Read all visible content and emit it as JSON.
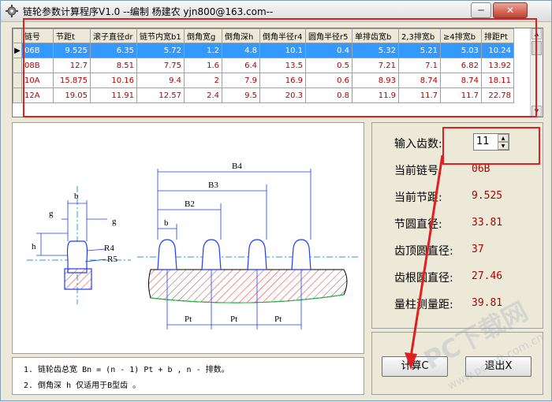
{
  "window": {
    "title": "链轮参数计算程序V1.0  --编制 杨建农 yjn800@163.com--",
    "minimize_glyph": "─",
    "close_glyph": "✕"
  },
  "grid": {
    "columns": [
      "链号",
      "节距t",
      "滚子直径dr",
      "链节内宽b1",
      "倒角宽g",
      "倒角深h",
      "倒角半径r4",
      "圆角半径r5",
      "单排齿宽b",
      "2,3排宽b",
      "≥4排宽b",
      "排距Pt"
    ],
    "rows": [
      {
        "selected": true,
        "cells": [
          "06B",
          "9.525",
          "6.35",
          "5.72",
          "1.2",
          "4.8",
          "10.1",
          "0.4",
          "5.32",
          "5.21",
          "5.03",
          "10.24"
        ]
      },
      {
        "selected": false,
        "cells": [
          "08B",
          "12.7",
          "8.51",
          "7.75",
          "1.6",
          "6.4",
          "13.5",
          "0.5",
          "7.21",
          "7.1",
          "6.82",
          "13.92"
        ]
      },
      {
        "selected": false,
        "cells": [
          "10A",
          "15.875",
          "10.16",
          "9.4",
          "2",
          "7.9",
          "16.9",
          "0.6",
          "8.93",
          "8.74",
          "8.74",
          "18.11"
        ]
      },
      {
        "selected": false,
        "cells": [
          "12A",
          "19.05",
          "11.91",
          "12.57",
          "2.4",
          "9.5",
          "20.3",
          "0.8",
          "11.9",
          "11.7",
          "11.7",
          "22.78"
        ]
      }
    ],
    "current_row_marker": "▶"
  },
  "drawing": {
    "labels": {
      "b": "b",
      "g": "g",
      "h": "h",
      "r4": "R4",
      "r5": "R5",
      "b2": "B2",
      "b3": "B3",
      "b4": "B4",
      "pt": "Pt"
    }
  },
  "info": {
    "teeth_label": "输入齿数:",
    "teeth_value": "11",
    "chain_no_label": "当前链号:",
    "chain_no_value": "06B",
    "pitch_label": "当前节距:",
    "pitch_value": "9.525",
    "pitch_circle_label": "节圆直径:",
    "pitch_circle_value": "33.81",
    "tip_circle_label": "齿顶圆直径:",
    "tip_circle_value": "37",
    "root_circle_label": "齿根圆直径:",
    "root_circle_value": "27.46",
    "measure_label": "量柱测量距:",
    "measure_value": "39.81"
  },
  "notes": {
    "line1": "1. 链轮齿总宽  Bn = (n - 1) Pt  + b , n - 排数。",
    "line2": "2. 倒角深 h 仅适用于B型齿 。"
  },
  "buttons": {
    "calc": "计算C",
    "exit": "退出X"
  },
  "watermark": {
    "main": "PC下载网",
    "sub": "www.pcsoft.com.cn"
  },
  "colors": {
    "value_red": "#b00000",
    "selection_blue": "#3399ff",
    "annotation_red": "#e02020",
    "drawing_blue": "#1e3cff",
    "hatch_red": "#e03030",
    "center_cyan": "#20a0c0"
  }
}
